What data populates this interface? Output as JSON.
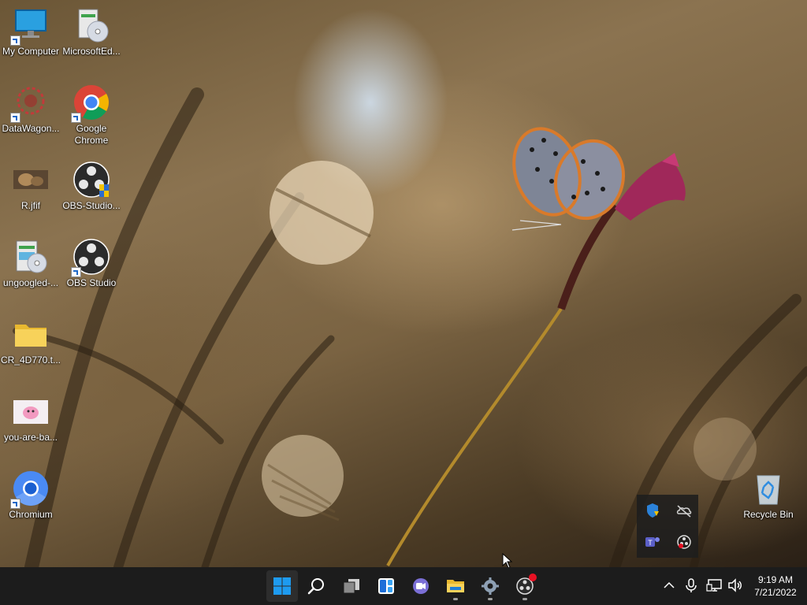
{
  "desktop": {
    "icons": [
      {
        "label": "My Computer",
        "icon": "monitor-icon"
      },
      {
        "label": "MicrosoftEd...",
        "icon": "installer-icon"
      },
      {
        "label": "DataWagon...",
        "icon": "datawagon-icon"
      },
      {
        "label": "Google Chrome",
        "label_line1": "Google",
        "label_line2": "Chrome",
        "icon": "chrome-icon"
      },
      {
        "label": "R.jfif",
        "icon": "image-file-icon"
      },
      {
        "label": "OBS-Studio...",
        "icon": "obs-installer-icon"
      },
      {
        "label": "ungoogled-...",
        "icon": "installer-icon"
      },
      {
        "label": "OBS Studio",
        "icon": "obs-icon"
      },
      {
        "label": "CR_4D770.t...",
        "icon": "folder-icon"
      },
      {
        "label": "you-are-ba...",
        "icon": "image-file-icon"
      },
      {
        "label": "Chromium",
        "icon": "chromium-icon"
      },
      {
        "label": "Recycle Bin",
        "icon": "recycle-bin-icon"
      }
    ]
  },
  "tray_popup": {
    "items": [
      "windows-security-warning-icon",
      "onedrive-offline-icon",
      "teams-icon",
      "obs-tray-icon"
    ]
  },
  "taskbar": {
    "apps": [
      "start-icon",
      "search-icon",
      "task-view-icon",
      "widgets-icon",
      "chat-icon",
      "file-explorer-icon",
      "settings-icon",
      "obs-icon"
    ],
    "system_tray": [
      "chevron-up-icon",
      "microphone-icon",
      "network-icon",
      "speaker-icon"
    ],
    "time": "9:19 AM",
    "date": "7/21/2022"
  },
  "colors": {
    "taskbar_bg": "#1c1c1c",
    "accent": "#0078d4",
    "notification_badge": "#e81123"
  }
}
